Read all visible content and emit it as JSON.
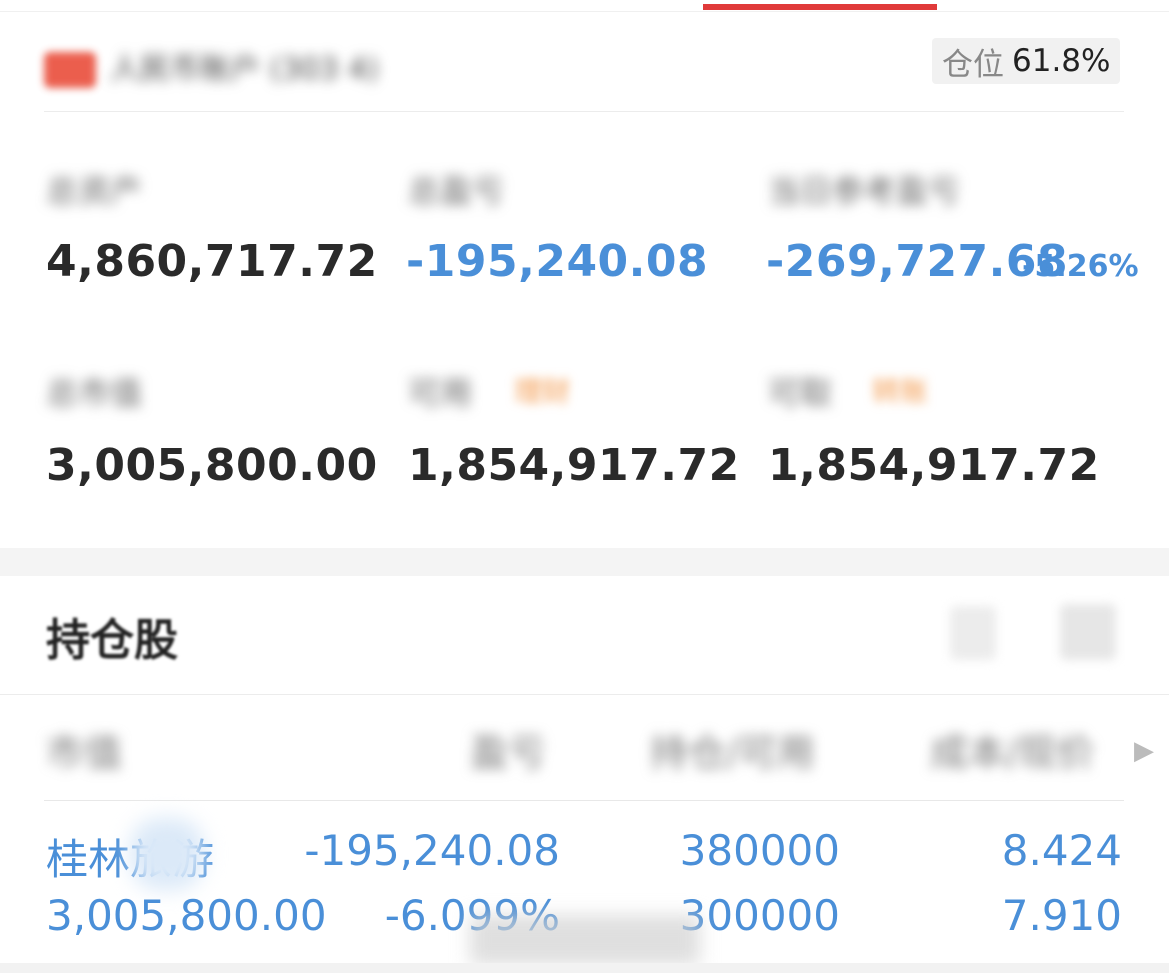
{
  "account": {
    "name": "人民币账户 (303 4)",
    "position_label": "仓位",
    "position_value": "61.8%"
  },
  "summary": {
    "total_assets_label": "总资产",
    "total_assets": "4,860,717.72",
    "pnl_label": "总盈亏",
    "pnl": "-195,240.08",
    "today_pnl_label": "当日参考盈亏",
    "today_pnl": "-269,727.68",
    "today_pnl_pct": "-5.26%",
    "market_value_label": "总市值",
    "market_value": "3,005,800.00",
    "available_label": "可用",
    "available_tag": "理财",
    "available": "1,854,917.72",
    "withdrawable_label": "可取",
    "withdrawable_tag": "转账",
    "withdrawable": "1,854,917.72"
  },
  "holdings": {
    "title": "持仓股",
    "columns": [
      "市值",
      "盈亏",
      "持仓/可用",
      "成本/现价"
    ],
    "rows": [
      {
        "name": "桂林旅游",
        "market_value": "3,005,800.00",
        "pnl": "-195,240.08",
        "pnl_pct": "-6.099%",
        "hold": "380000",
        "available": "300000",
        "cost": "8.424",
        "price": "7.910"
      }
    ]
  },
  "colors": {
    "accent_red": "#e03a3a",
    "loss_blue": "#4a8fd8",
    "tag_orange": "#f39a4e"
  }
}
